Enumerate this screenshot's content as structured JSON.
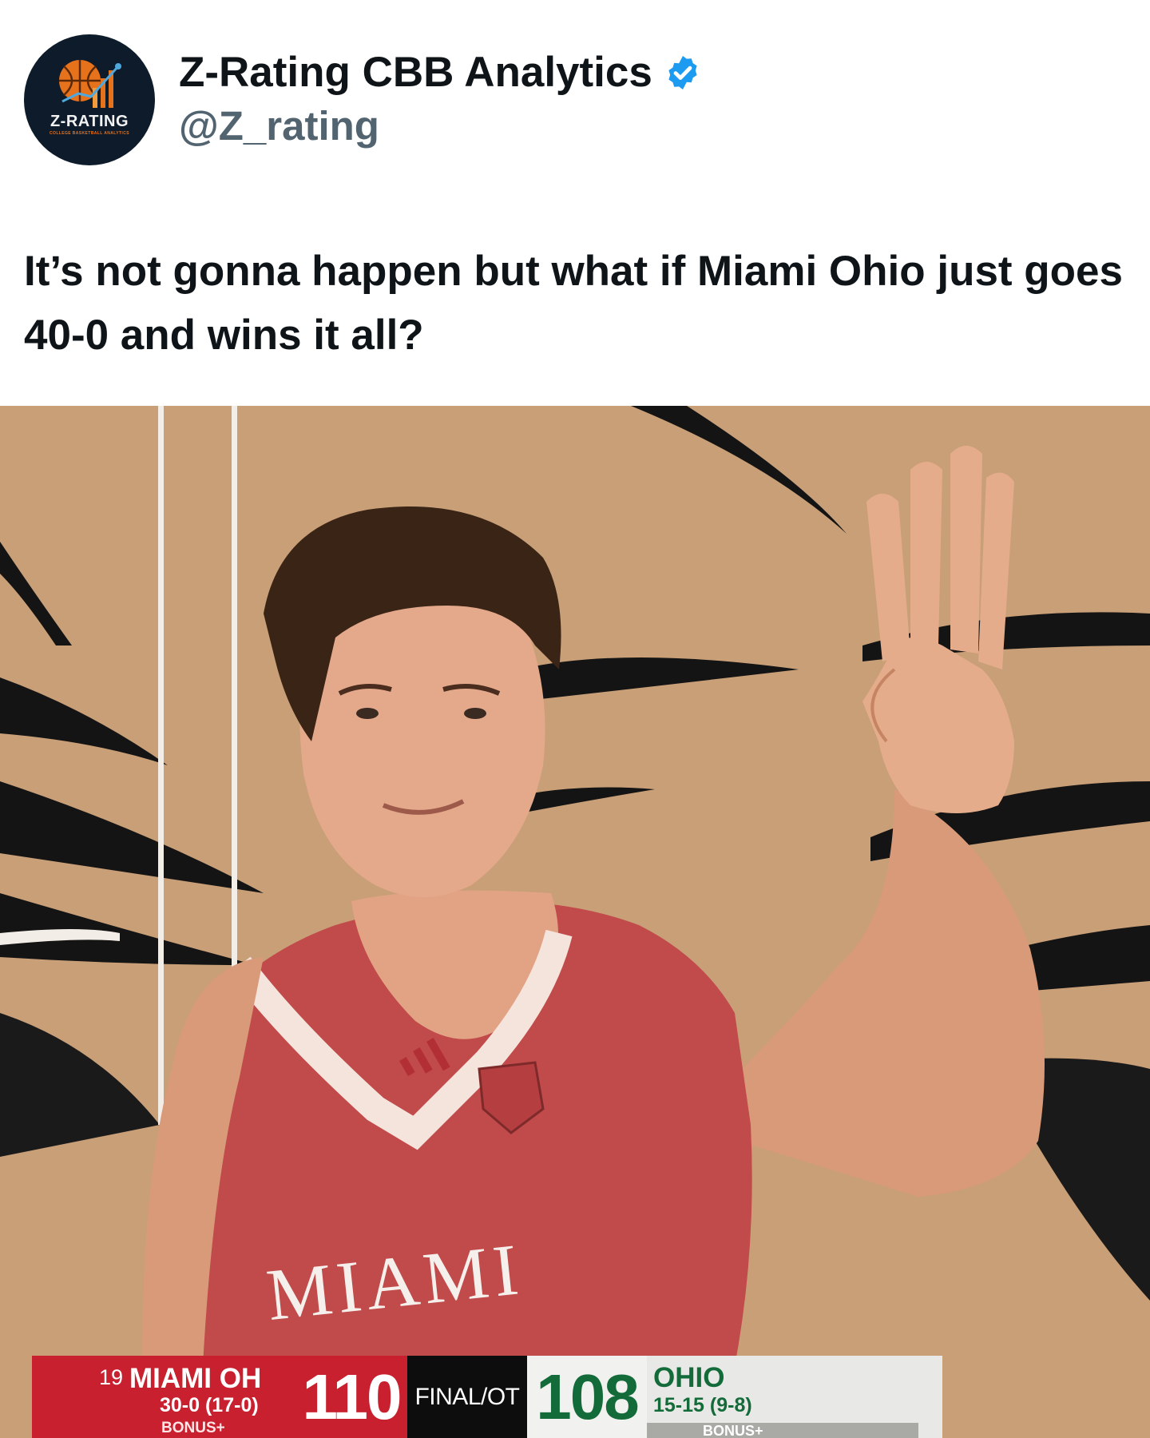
{
  "author": {
    "display_name": "Z-Rating CBB Analytics",
    "handle": "@Z_rating",
    "verified": true,
    "avatar_text": "Z-RATING",
    "avatar_subtext": "COLLEGE BASKETBALL ANALYTICS",
    "avatar_icon": "basketball-chart-logo"
  },
  "tweet": {
    "text": "It’s not gonna happen but what if Miami Ohio just goes 40-0 and wins it all?"
  },
  "media": {
    "jersey_text": "MIAMI",
    "scoreboard": {
      "home_rank": "19",
      "home_name": "MIAMI OH",
      "home_record": "30-0 (17-0)",
      "home_bonus": "BONUS+",
      "home_score": "110",
      "status": "FINAL/OT",
      "away_score": "108",
      "away_name": "OHIO",
      "away_record": "15-15 (9-8)",
      "away_bonus": "BONUS+"
    }
  },
  "colors": {
    "verified_blue": "#1d9bf0",
    "miami_red": "#c8202f",
    "ohio_green": "#146b3a",
    "court_tan": "#c79e78"
  }
}
